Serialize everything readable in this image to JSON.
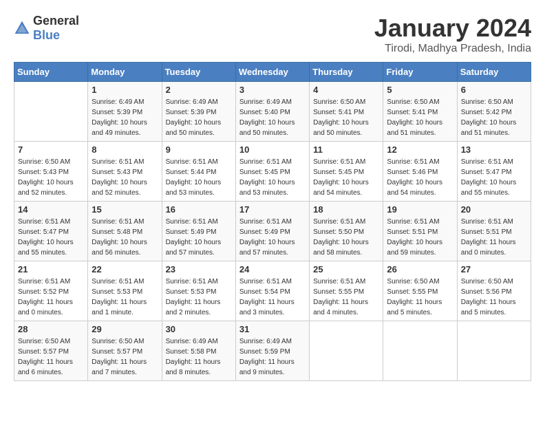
{
  "logo": {
    "text_general": "General",
    "text_blue": "Blue"
  },
  "title": "January 2024",
  "location": "Tirodi, Madhya Pradesh, India",
  "weekdays": [
    "Sunday",
    "Monday",
    "Tuesday",
    "Wednesday",
    "Thursday",
    "Friday",
    "Saturday"
  ],
  "weeks": [
    [
      {
        "day": "",
        "sunrise": "",
        "sunset": "",
        "daylight": ""
      },
      {
        "day": "1",
        "sunrise": "Sunrise: 6:49 AM",
        "sunset": "Sunset: 5:39 PM",
        "daylight": "Daylight: 10 hours and 49 minutes."
      },
      {
        "day": "2",
        "sunrise": "Sunrise: 6:49 AM",
        "sunset": "Sunset: 5:39 PM",
        "daylight": "Daylight: 10 hours and 50 minutes."
      },
      {
        "day": "3",
        "sunrise": "Sunrise: 6:49 AM",
        "sunset": "Sunset: 5:40 PM",
        "daylight": "Daylight: 10 hours and 50 minutes."
      },
      {
        "day": "4",
        "sunrise": "Sunrise: 6:50 AM",
        "sunset": "Sunset: 5:41 PM",
        "daylight": "Daylight: 10 hours and 50 minutes."
      },
      {
        "day": "5",
        "sunrise": "Sunrise: 6:50 AM",
        "sunset": "Sunset: 5:41 PM",
        "daylight": "Daylight: 10 hours and 51 minutes."
      },
      {
        "day": "6",
        "sunrise": "Sunrise: 6:50 AM",
        "sunset": "Sunset: 5:42 PM",
        "daylight": "Daylight: 10 hours and 51 minutes."
      }
    ],
    [
      {
        "day": "7",
        "sunrise": "Sunrise: 6:50 AM",
        "sunset": "Sunset: 5:43 PM",
        "daylight": "Daylight: 10 hours and 52 minutes."
      },
      {
        "day": "8",
        "sunrise": "Sunrise: 6:51 AM",
        "sunset": "Sunset: 5:43 PM",
        "daylight": "Daylight: 10 hours and 52 minutes."
      },
      {
        "day": "9",
        "sunrise": "Sunrise: 6:51 AM",
        "sunset": "Sunset: 5:44 PM",
        "daylight": "Daylight: 10 hours and 53 minutes."
      },
      {
        "day": "10",
        "sunrise": "Sunrise: 6:51 AM",
        "sunset": "Sunset: 5:45 PM",
        "daylight": "Daylight: 10 hours and 53 minutes."
      },
      {
        "day": "11",
        "sunrise": "Sunrise: 6:51 AM",
        "sunset": "Sunset: 5:45 PM",
        "daylight": "Daylight: 10 hours and 54 minutes."
      },
      {
        "day": "12",
        "sunrise": "Sunrise: 6:51 AM",
        "sunset": "Sunset: 5:46 PM",
        "daylight": "Daylight: 10 hours and 54 minutes."
      },
      {
        "day": "13",
        "sunrise": "Sunrise: 6:51 AM",
        "sunset": "Sunset: 5:47 PM",
        "daylight": "Daylight: 10 hours and 55 minutes."
      }
    ],
    [
      {
        "day": "14",
        "sunrise": "Sunrise: 6:51 AM",
        "sunset": "Sunset: 5:47 PM",
        "daylight": "Daylight: 10 hours and 55 minutes."
      },
      {
        "day": "15",
        "sunrise": "Sunrise: 6:51 AM",
        "sunset": "Sunset: 5:48 PM",
        "daylight": "Daylight: 10 hours and 56 minutes."
      },
      {
        "day": "16",
        "sunrise": "Sunrise: 6:51 AM",
        "sunset": "Sunset: 5:49 PM",
        "daylight": "Daylight: 10 hours and 57 minutes."
      },
      {
        "day": "17",
        "sunrise": "Sunrise: 6:51 AM",
        "sunset": "Sunset: 5:49 PM",
        "daylight": "Daylight: 10 hours and 57 minutes."
      },
      {
        "day": "18",
        "sunrise": "Sunrise: 6:51 AM",
        "sunset": "Sunset: 5:50 PM",
        "daylight": "Daylight: 10 hours and 58 minutes."
      },
      {
        "day": "19",
        "sunrise": "Sunrise: 6:51 AM",
        "sunset": "Sunset: 5:51 PM",
        "daylight": "Daylight: 10 hours and 59 minutes."
      },
      {
        "day": "20",
        "sunrise": "Sunrise: 6:51 AM",
        "sunset": "Sunset: 5:51 PM",
        "daylight": "Daylight: 11 hours and 0 minutes."
      }
    ],
    [
      {
        "day": "21",
        "sunrise": "Sunrise: 6:51 AM",
        "sunset": "Sunset: 5:52 PM",
        "daylight": "Daylight: 11 hours and 0 minutes."
      },
      {
        "day": "22",
        "sunrise": "Sunrise: 6:51 AM",
        "sunset": "Sunset: 5:53 PM",
        "daylight": "Daylight: 11 hours and 1 minute."
      },
      {
        "day": "23",
        "sunrise": "Sunrise: 6:51 AM",
        "sunset": "Sunset: 5:53 PM",
        "daylight": "Daylight: 11 hours and 2 minutes."
      },
      {
        "day": "24",
        "sunrise": "Sunrise: 6:51 AM",
        "sunset": "Sunset: 5:54 PM",
        "daylight": "Daylight: 11 hours and 3 minutes."
      },
      {
        "day": "25",
        "sunrise": "Sunrise: 6:51 AM",
        "sunset": "Sunset: 5:55 PM",
        "daylight": "Daylight: 11 hours and 4 minutes."
      },
      {
        "day": "26",
        "sunrise": "Sunrise: 6:50 AM",
        "sunset": "Sunset: 5:55 PM",
        "daylight": "Daylight: 11 hours and 5 minutes."
      },
      {
        "day": "27",
        "sunrise": "Sunrise: 6:50 AM",
        "sunset": "Sunset: 5:56 PM",
        "daylight": "Daylight: 11 hours and 5 minutes."
      }
    ],
    [
      {
        "day": "28",
        "sunrise": "Sunrise: 6:50 AM",
        "sunset": "Sunset: 5:57 PM",
        "daylight": "Daylight: 11 hours and 6 minutes."
      },
      {
        "day": "29",
        "sunrise": "Sunrise: 6:50 AM",
        "sunset": "Sunset: 5:57 PM",
        "daylight": "Daylight: 11 hours and 7 minutes."
      },
      {
        "day": "30",
        "sunrise": "Sunrise: 6:49 AM",
        "sunset": "Sunset: 5:58 PM",
        "daylight": "Daylight: 11 hours and 8 minutes."
      },
      {
        "day": "31",
        "sunrise": "Sunrise: 6:49 AM",
        "sunset": "Sunset: 5:59 PM",
        "daylight": "Daylight: 11 hours and 9 minutes."
      },
      {
        "day": "",
        "sunrise": "",
        "sunset": "",
        "daylight": ""
      },
      {
        "day": "",
        "sunrise": "",
        "sunset": "",
        "daylight": ""
      },
      {
        "day": "",
        "sunrise": "",
        "sunset": "",
        "daylight": ""
      }
    ]
  ]
}
